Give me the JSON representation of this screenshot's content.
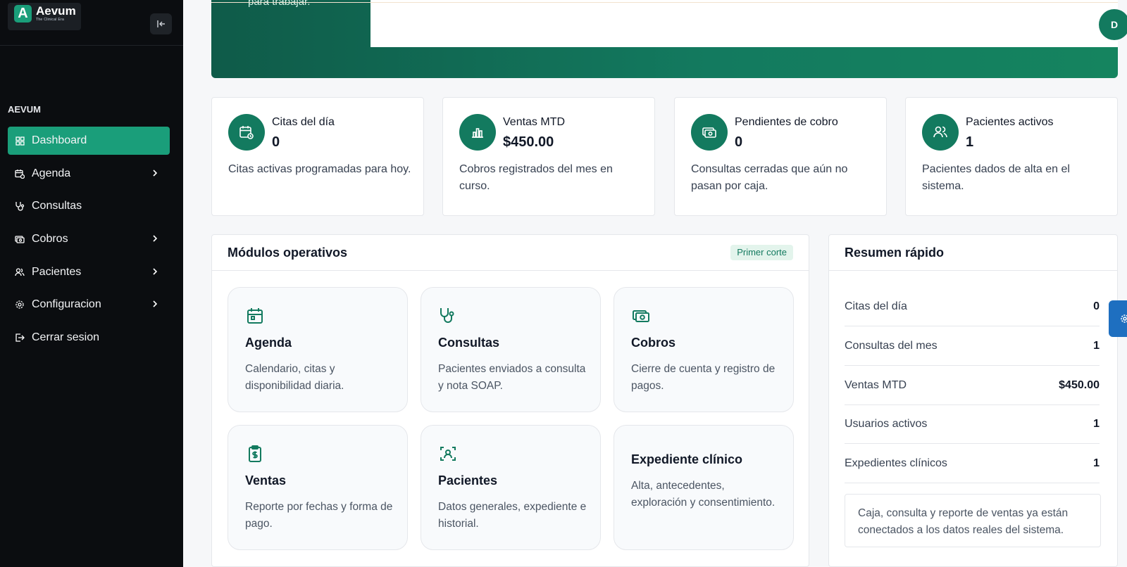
{
  "brand": {
    "name": "Aevum",
    "tagline": "The Clinical Era",
    "logo_letter": "A"
  },
  "sidebar": {
    "section_label": "AEVUM",
    "items": [
      {
        "label": "Dashboard",
        "icon": "grid-icon",
        "active": true
      },
      {
        "label": "Agenda",
        "icon": "calendar-clock-icon",
        "has_chevron": true
      },
      {
        "label": "Consultas",
        "icon": "stethoscope-icon"
      },
      {
        "label": "Cobros",
        "icon": "banknote-icon",
        "has_chevron": true
      },
      {
        "label": "Pacientes",
        "icon": "users-icon",
        "has_chevron": true
      },
      {
        "label": "Configuracion",
        "icon": "gear-icon",
        "has_chevron": true
      },
      {
        "label": "Cerrar sesion",
        "icon": "logout-icon"
      }
    ]
  },
  "header": {
    "partial_text": "para trabajar.",
    "avatar_letter": "D"
  },
  "stats": [
    {
      "label": "Citas del día",
      "value": "0",
      "desc": "Citas activas programadas para hoy.",
      "icon": "calendar-clock-icon"
    },
    {
      "label": "Ventas MTD",
      "value": "$450.00",
      "desc": "Cobros registrados del mes en curso.",
      "icon": "bar-chart-icon"
    },
    {
      "label": "Pendientes de cobro",
      "value": "0",
      "desc": "Consultas cerradas que aún no pasan por caja.",
      "icon": "banknote-icon"
    },
    {
      "label": "Pacientes activos",
      "value": "1",
      "desc": "Pacientes dados de alta en el sistema.",
      "icon": "users-icon"
    }
  ],
  "modules_panel": {
    "title": "Módulos operativos",
    "badge": "Primer corte",
    "modules": [
      {
        "title": "Agenda",
        "desc": "Calendario, citas y disponibilidad diaria.",
        "icon": "calendar-icon"
      },
      {
        "title": "Consultas",
        "desc": "Pacientes enviados a consulta y nota SOAP.",
        "icon": "stethoscope-icon"
      },
      {
        "title": "Cobros",
        "desc": "Cierre de cuenta y registro de pagos.",
        "icon": "banknote-icon"
      },
      {
        "title": "Ventas",
        "desc": "Reporte por fechas y forma de pago.",
        "icon": "clipboard-dollar-icon"
      },
      {
        "title": "Pacientes",
        "desc": "Datos generales, expediente e historial.",
        "icon": "scan-user-icon"
      },
      {
        "title": "Expediente clínico",
        "desc": "Alta, antecedentes, exploración y consentimiento."
      }
    ]
  },
  "summary_panel": {
    "title": "Resumen rápido",
    "rows": [
      {
        "label": "Citas del día",
        "value": "0"
      },
      {
        "label": "Consultas del mes",
        "value": "1"
      },
      {
        "label": "Ventas MTD",
        "value": "$450.00"
      },
      {
        "label": "Usuarios activos",
        "value": "1"
      },
      {
        "label": "Expedientes clínicos",
        "value": "1"
      }
    ],
    "note": "Caja, consulta y reporte de ventas ya están conectados a los datos reales del sistema."
  },
  "colors": {
    "accent": "#1a9e7a",
    "accent_dark": "#137a5f",
    "sidebar_bg": "#0b0d10"
  }
}
